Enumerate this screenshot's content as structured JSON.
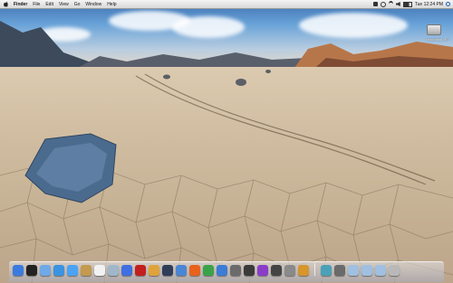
{
  "menubar": {
    "app_name": "Finder",
    "items": [
      "File",
      "Edit",
      "View",
      "Go",
      "Window",
      "Help"
    ],
    "clock": "Tue 12:24 PM"
  },
  "desktop": {
    "hard_drive_label": "Macintosh HD"
  },
  "dock": {
    "apps": [
      {
        "name": "finder-icon",
        "color": "#3a7be0"
      },
      {
        "name": "dashboard-icon",
        "color": "#222222"
      },
      {
        "name": "mail-icon",
        "color": "#6fa9e8"
      },
      {
        "name": "safari-icon",
        "color": "#3b93e2"
      },
      {
        "name": "ichat-icon",
        "color": "#4aa3f5"
      },
      {
        "name": "address-book-icon",
        "color": "#c49a4e"
      },
      {
        "name": "ical-icon",
        "color": "#f2f2f2"
      },
      {
        "name": "preview-icon",
        "color": "#9fb7c9"
      },
      {
        "name": "itunes-icon",
        "color": "#3f6fe0"
      },
      {
        "name": "photo-booth-icon",
        "color": "#c21f1f"
      },
      {
        "name": "iphoto-icon",
        "color": "#e0a33b"
      },
      {
        "name": "time-machine-icon",
        "color": "#2f3d59"
      },
      {
        "name": "quicksilver-icon",
        "color": "#4a86d4"
      },
      {
        "name": "firefox-icon",
        "color": "#e8621c"
      },
      {
        "name": "chrome-icon",
        "color": "#3aa34a"
      },
      {
        "name": "xcode-icon",
        "color": "#3b7cd6"
      },
      {
        "name": "system-preferences-icon",
        "color": "#6b6b6b"
      },
      {
        "name": "spaces-icon",
        "color": "#3a3a3a"
      },
      {
        "name": "frontrow-icon",
        "color": "#8a3cc9"
      },
      {
        "name": "expose-icon",
        "color": "#444444"
      },
      {
        "name": "automator-icon",
        "color": "#8a8a8a"
      },
      {
        "name": "preferences-gear-icon",
        "color": "#d6962b"
      }
    ],
    "right": [
      {
        "name": "utilities-icon",
        "color": "#4aa1b8"
      },
      {
        "name": "network-icon",
        "color": "#6a6a6a"
      },
      {
        "name": "applications-folder-icon",
        "color": "#9fc0e0"
      },
      {
        "name": "documents-folder-icon",
        "color": "#9fc0e0"
      },
      {
        "name": "downloads-folder-icon",
        "color": "#9fc0e0"
      },
      {
        "name": "trash-icon",
        "color": "#b9b9b9"
      }
    ]
  }
}
